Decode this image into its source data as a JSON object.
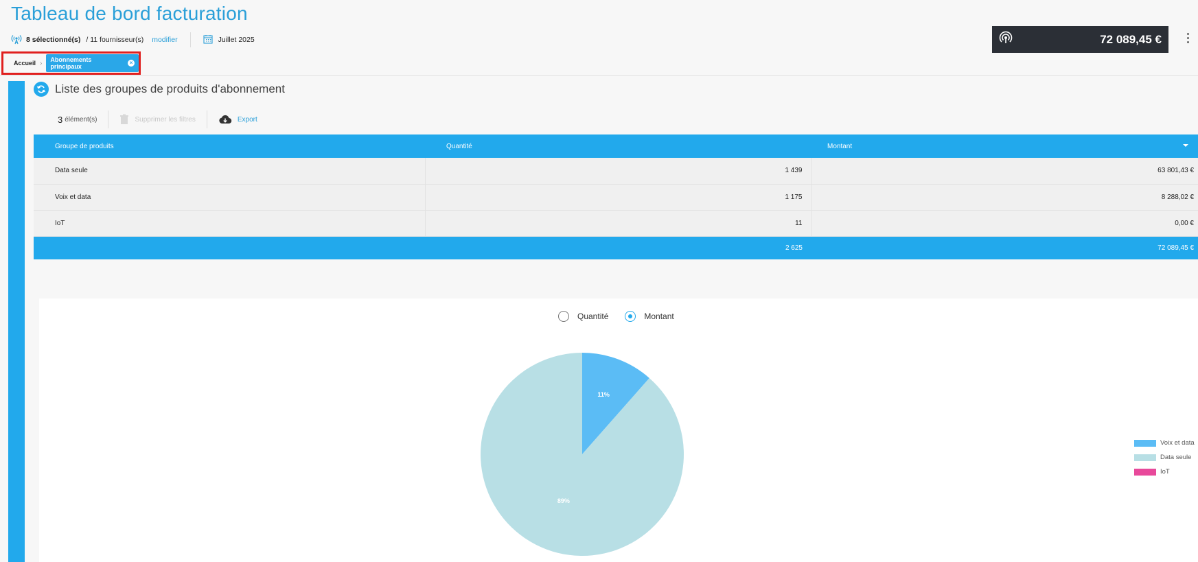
{
  "header": {
    "title": "Tableau de bord facturation",
    "selection": "8 sélectionné(s)",
    "suppliers": "/ 11 fournisseur(s)",
    "modify_link": "modifier",
    "period": "Juillet 2025",
    "total_amount": "72 089,45 €"
  },
  "breadcrumb": {
    "home": "Accueil",
    "current": "Abonnements principaux"
  },
  "section": {
    "title": "Liste des groupes de produits d'abonnement",
    "count": "3",
    "count_label": "élément(s)",
    "clear_filters": "Supprimer les filtres",
    "export": "Export"
  },
  "table": {
    "columns": [
      "Groupe de produits",
      "Quantité",
      "Montant"
    ],
    "rows": [
      {
        "group": "Data seule",
        "quantity": "1 439",
        "amount": "63 801,43 €"
      },
      {
        "group": "Voix et data",
        "quantity": "1 175",
        "amount": "8 288,02 €"
      },
      {
        "group": "IoT",
        "quantity": "11",
        "amount": "0,00 €"
      }
    ],
    "totals": {
      "quantity": "2 625",
      "amount": "72 089,45 €"
    }
  },
  "chart_toggle": {
    "options": [
      "Quantité",
      "Montant"
    ],
    "selected": "Montant"
  },
  "chart_data": {
    "type": "pie",
    "categories": [
      "Voix et data",
      "Data seule",
      "IoT"
    ],
    "values": [
      8288.02,
      63801.43,
      0.0
    ],
    "labels": [
      "11%",
      "89%",
      ""
    ],
    "colors": [
      "#5bbcf5",
      "#b8dfe5",
      "#e8499b"
    ],
    "legend_position": "right"
  },
  "colors": {
    "accent": "#22a9ec",
    "title": "#2a9fd8",
    "highlight_box": "#e0201f",
    "total_box": "#2b2f36"
  }
}
